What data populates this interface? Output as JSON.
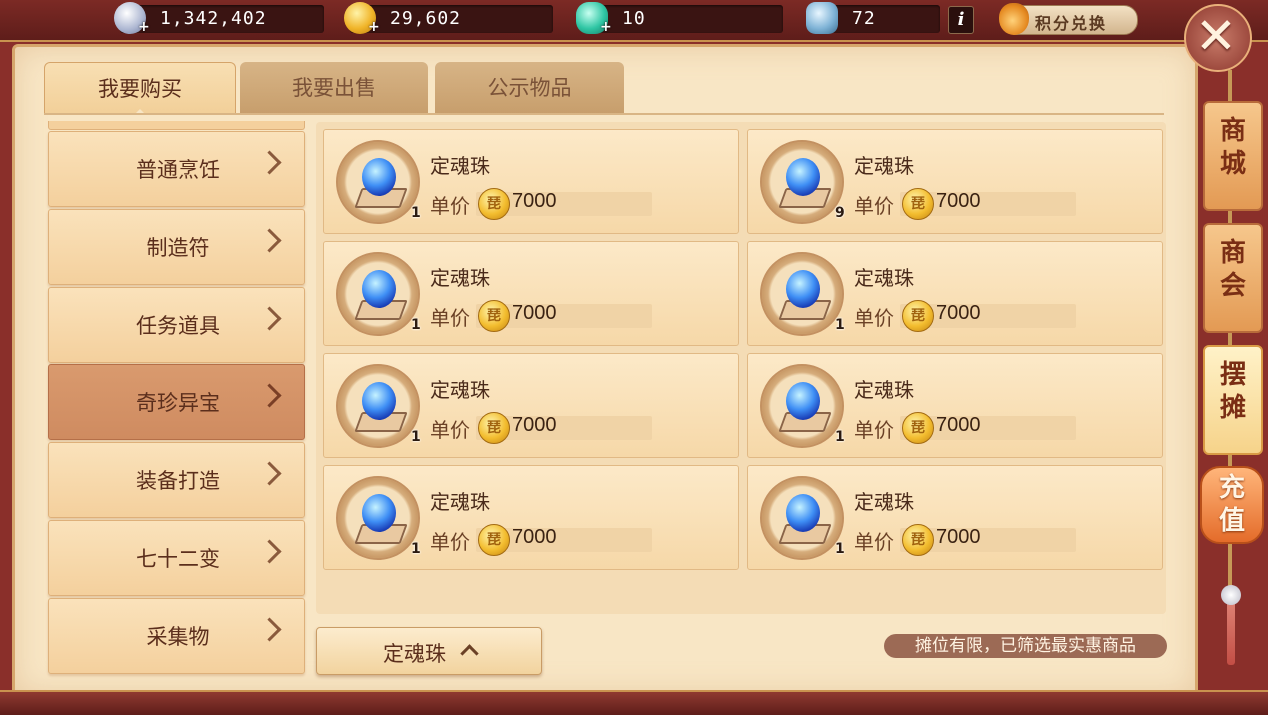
{
  "currencies": [
    {
      "icon": "silver-coin-icon",
      "value": "1,342,402"
    },
    {
      "icon": "gold-coin-icon",
      "value": "29,602"
    },
    {
      "icon": "jade-icon",
      "value": "10"
    },
    {
      "icon": "treasure-pot-icon",
      "value": "72"
    }
  ],
  "info_label": "i",
  "points_exchange_label": "积分兑换",
  "close_label": "✕",
  "tabs": [
    {
      "label": "我要购买",
      "active": true
    },
    {
      "label": "我要出售",
      "active": false
    },
    {
      "label": "公示物品",
      "active": false
    }
  ],
  "categories": [
    {
      "label": "普通烹饪",
      "active": false
    },
    {
      "label": "制造符",
      "active": false
    },
    {
      "label": "任务道具",
      "active": false
    },
    {
      "label": "奇珍异宝",
      "active": true
    },
    {
      "label": "装备打造",
      "active": false
    },
    {
      "label": "七十二变",
      "active": false
    },
    {
      "label": "采集物",
      "active": false
    }
  ],
  "price_label": "单价",
  "coin_glyph": "琵",
  "items": [
    {
      "name": "定魂珠",
      "count": "1",
      "price": "7000"
    },
    {
      "name": "定魂珠",
      "count": "9",
      "price": "7000"
    },
    {
      "name": "定魂珠",
      "count": "1",
      "price": "7000"
    },
    {
      "name": "定魂珠",
      "count": "1",
      "price": "7000"
    },
    {
      "name": "定魂珠",
      "count": "1",
      "price": "7000"
    },
    {
      "name": "定魂珠",
      "count": "1",
      "price": "7000"
    },
    {
      "name": "定魂珠",
      "count": "1",
      "price": "7000"
    },
    {
      "name": "定魂珠",
      "count": "1",
      "price": "7000"
    }
  ],
  "filter_button_label": "定魂珠",
  "notice": "摊位有限，已筛选最实惠商品",
  "side_tabs": [
    {
      "label_top": "商",
      "label_bottom": "城",
      "active": false
    },
    {
      "label_top": "商",
      "label_bottom": "会",
      "active": false
    },
    {
      "label_top": "摆",
      "label_bottom": "摊",
      "active": true
    }
  ],
  "recharge": {
    "label_top": "充",
    "label_bottom": "值"
  }
}
